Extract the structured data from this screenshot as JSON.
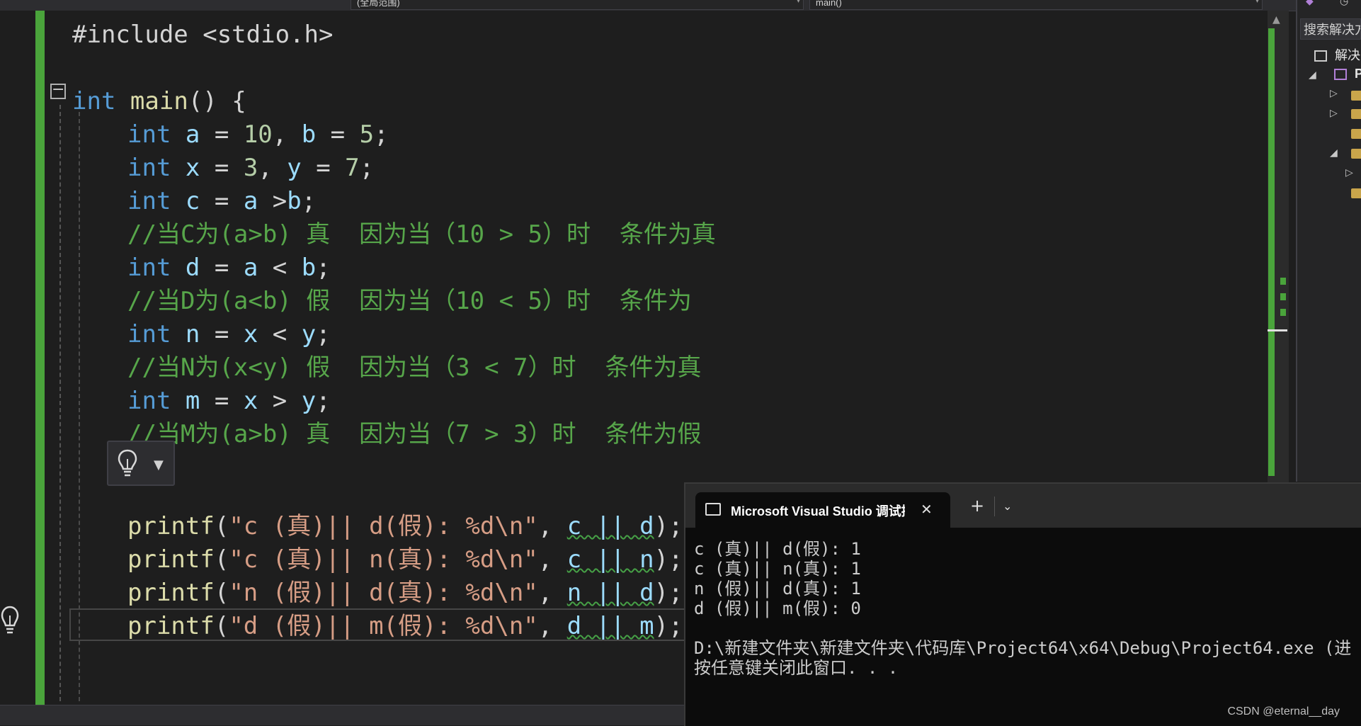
{
  "toolbar": {
    "scope_label": "(全局范围)",
    "member_label": "main()"
  },
  "code": {
    "lines": [
      {
        "id": "line-include",
        "tokens": [
          {
            "t": "pl",
            "v": "#include <stdio.h>"
          }
        ]
      },
      {
        "id": "line-main",
        "tokens": [
          {
            "t": "kw",
            "v": "int"
          },
          {
            "t": "pl",
            "v": " "
          },
          {
            "t": "fn",
            "v": "main"
          },
          {
            "t": "pl",
            "v": "() {"
          }
        ]
      },
      {
        "id": "line-decl-ab",
        "tokens": [
          {
            "t": "kw",
            "v": "int"
          },
          {
            "t": "pl",
            "v": " "
          },
          {
            "t": "var",
            "v": "a"
          },
          {
            "t": "pl",
            "v": " = "
          },
          {
            "t": "num",
            "v": "10"
          },
          {
            "t": "pl",
            "v": ", "
          },
          {
            "t": "var",
            "v": "b"
          },
          {
            "t": "pl",
            "v": " = "
          },
          {
            "t": "num",
            "v": "5"
          },
          {
            "t": "pl",
            "v": ";"
          }
        ]
      },
      {
        "id": "line-decl-xy",
        "tokens": [
          {
            "t": "kw",
            "v": "int"
          },
          {
            "t": "pl",
            "v": " "
          },
          {
            "t": "var",
            "v": "x"
          },
          {
            "t": "pl",
            "v": " = "
          },
          {
            "t": "num",
            "v": "3"
          },
          {
            "t": "pl",
            "v": ", "
          },
          {
            "t": "var",
            "v": "y"
          },
          {
            "t": "pl",
            "v": " = "
          },
          {
            "t": "num",
            "v": "7"
          },
          {
            "t": "pl",
            "v": ";"
          }
        ]
      },
      {
        "id": "line-decl-c",
        "tokens": [
          {
            "t": "kw",
            "v": "int"
          },
          {
            "t": "pl",
            "v": " "
          },
          {
            "t": "var",
            "v": "c"
          },
          {
            "t": "pl",
            "v": " = "
          },
          {
            "t": "var",
            "v": "a"
          },
          {
            "t": "pl",
            "v": " >"
          },
          {
            "t": "var",
            "v": "b"
          },
          {
            "t": "pl",
            "v": ";"
          }
        ]
      },
      {
        "id": "line-comment-c",
        "tokens": [
          {
            "t": "cm",
            "v": "//当C为(a>b) 真  因为当（10 > 5）时  条件为真"
          }
        ]
      },
      {
        "id": "line-decl-d",
        "tokens": [
          {
            "t": "kw",
            "v": "int"
          },
          {
            "t": "pl",
            "v": " "
          },
          {
            "t": "var",
            "v": "d"
          },
          {
            "t": "pl",
            "v": " = "
          },
          {
            "t": "var",
            "v": "a"
          },
          {
            "t": "pl",
            "v": " < "
          },
          {
            "t": "var",
            "v": "b"
          },
          {
            "t": "pl",
            "v": ";"
          }
        ]
      },
      {
        "id": "line-comment-d",
        "tokens": [
          {
            "t": "cm",
            "v": "//当D为(a<b) 假  因为当（10 < 5）时  条件为"
          }
        ]
      },
      {
        "id": "line-decl-n",
        "tokens": [
          {
            "t": "kw",
            "v": "int"
          },
          {
            "t": "pl",
            "v": " "
          },
          {
            "t": "var",
            "v": "n"
          },
          {
            "t": "pl",
            "v": " = "
          },
          {
            "t": "var",
            "v": "x"
          },
          {
            "t": "pl",
            "v": " < "
          },
          {
            "t": "var",
            "v": "y"
          },
          {
            "t": "pl",
            "v": ";"
          }
        ]
      },
      {
        "id": "line-comment-n",
        "tokens": [
          {
            "t": "cm",
            "v": "//当N为(x<y) 假  因为当（3 < 7）时  条件为真"
          }
        ]
      },
      {
        "id": "line-decl-m",
        "tokens": [
          {
            "t": "kw",
            "v": "int"
          },
          {
            "t": "pl",
            "v": " "
          },
          {
            "t": "var",
            "v": "m"
          },
          {
            "t": "pl",
            "v": " = "
          },
          {
            "t": "var",
            "v": "x"
          },
          {
            "t": "pl",
            "v": " > "
          },
          {
            "t": "var",
            "v": "y"
          },
          {
            "t": "pl",
            "v": ";"
          }
        ]
      },
      {
        "id": "line-comment-m",
        "tokens": [
          {
            "t": "cm",
            "v": "//当M为(a>b) 真  因为当（7 > 3）时  条件为假"
          }
        ]
      },
      {
        "id": "line-printf-1",
        "tokens": [
          {
            "t": "fn",
            "v": "printf"
          },
          {
            "t": "pl",
            "v": "("
          },
          {
            "t": "str",
            "v": "\"c (真)|| d(假): %d\\n\""
          },
          {
            "t": "pl",
            "v": ", "
          },
          {
            "t": "sq",
            "v": "c || d"
          },
          {
            "t": "pl",
            "v": ");"
          }
        ]
      },
      {
        "id": "line-printf-2",
        "tokens": [
          {
            "t": "fn",
            "v": "printf"
          },
          {
            "t": "pl",
            "v": "("
          },
          {
            "t": "str",
            "v": "\"c (真)|| n(真): %d\\n\""
          },
          {
            "t": "pl",
            "v": ", "
          },
          {
            "t": "sq",
            "v": "c || n"
          },
          {
            "t": "pl",
            "v": ");"
          }
        ]
      },
      {
        "id": "line-printf-3",
        "tokens": [
          {
            "t": "fn",
            "v": "printf"
          },
          {
            "t": "pl",
            "v": "("
          },
          {
            "t": "str",
            "v": "\"n (假)|| d(真): %d\\n\""
          },
          {
            "t": "pl",
            "v": ", "
          },
          {
            "t": "sq",
            "v": "n || d"
          },
          {
            "t": "pl",
            "v": ");"
          }
        ]
      },
      {
        "id": "line-printf-4",
        "tokens": [
          {
            "t": "fn",
            "v": "printf"
          },
          {
            "t": "pl",
            "v": "("
          },
          {
            "t": "str",
            "v": "\"d (假)|| m(假): %d\\n\""
          },
          {
            "t": "pl",
            "v": ", "
          },
          {
            "t": "sq",
            "v": "d || m"
          },
          {
            "t": "pl",
            "v": ");"
          }
        ]
      }
    ]
  },
  "solution_explorer": {
    "search_placeholder": "搜索解决方",
    "solution_label": "解决方",
    "project_label": "P"
  },
  "console": {
    "tab_title": "Microsoft Visual Studio 调试控制台",
    "close_glyph": "✕",
    "add_glyph": "+",
    "dropdown_glyph": "⌄",
    "output_lines": [
      "c (真)|| d(假): 1",
      "c (真)|| n(真): 1",
      "n (假)|| d(真): 1",
      "d (假)|| m(假): 0",
      "",
      "D:\\新建文件夹\\新建文件夹\\代码库\\Project64\\x64\\Debug\\Project64.exe (进",
      "按任意键关闭此窗口. . ."
    ]
  },
  "watermark": "CSDN @eternal__day",
  "colors": {
    "keyword": "#569cd6",
    "comment": "#57a64a",
    "string": "#d69d85",
    "number": "#b5cea8",
    "variable": "#9cdcfe",
    "function": "#dcdcaa",
    "change_bar": "#4aa43b"
  }
}
